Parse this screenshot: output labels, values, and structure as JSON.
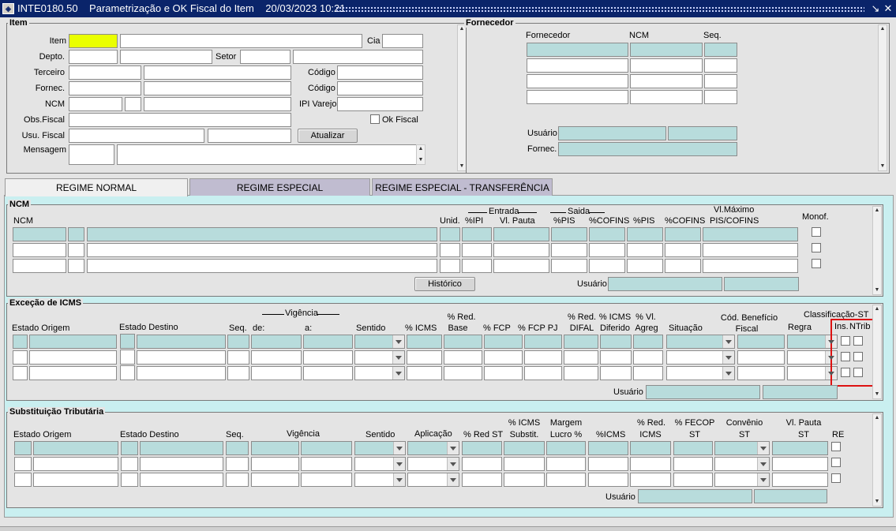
{
  "window": {
    "title": "INTE0180.50    Parametrização e OK Fiscal do Item    20/03/2023 10:21",
    "icon": "app-icon",
    "controls": [
      "chevron-down-icon",
      "close-icon"
    ]
  },
  "item": {
    "title": "Item",
    "labels": {
      "item": "Item",
      "cia": "Cia",
      "depto": "Depto.",
      "setor": "Setor",
      "terceiro": "Terceiro",
      "codigo1": "Código",
      "fornec": "Fornec.",
      "codigo2": "Código",
      "ncm": "NCM",
      "ipi_varejo": "IPI Varejo",
      "obs_fiscal": "Obs.Fiscal",
      "ok_fiscal": "Ok Fiscal",
      "usu_fiscal": "Usu. Fiscal",
      "mensagem": "Mensagem"
    },
    "atualizar": "Atualizar"
  },
  "fornecedor": {
    "title": "Fornecedor",
    "cols": {
      "fornecedor": "Fornecedor",
      "ncm": "NCM",
      "seq": "Seq."
    },
    "usuario": "Usuário",
    "fornec": "Fornec."
  },
  "tabs": [
    {
      "label": "REGIME NORMAL",
      "active": true
    },
    {
      "label": "REGIME ESPECIAL",
      "active": false
    },
    {
      "label": "REGIME ESPECIAL - TRANSFERÊNCIA",
      "active": false
    }
  ],
  "ncm_section": {
    "title": "NCM",
    "entrada": "Entrada",
    "saida": "Saida",
    "cols": {
      "ncm": "NCM",
      "unid": "Unid.",
      "pipi": "%IPI",
      "vl_pauta": "Vl. Pauta",
      "ppis": "%PIS",
      "pcofins": "%COFINS",
      "ppis2": "%PIS",
      "pcofins2": "%COFINS",
      "vl_max_1": "Vl.Máximo",
      "vl_max_2": "PIS/COFINS",
      "monof": "Monof."
    },
    "historico": "Histórico",
    "usuario": "Usuário"
  },
  "icms_section": {
    "title": "Exceção de ICMS",
    "vigencia": "Vigência",
    "class_st": "Classificação-ST",
    "cols": {
      "estado_origem": "Estado Origem",
      "estado_destino": "Estado Destino",
      "seq": "Seq.",
      "de": "de:",
      "a": "a:",
      "sentido": "Sentido",
      "picms": "% ICMS",
      "red_base_1": "% Red.",
      "red_base_2": "Base",
      "pfcp": "% FCP",
      "pfcp_pj": "% FCP PJ",
      "red_difal_1": "% Red.",
      "red_difal_2": "DIFAL",
      "icms_dif_1": "% ICMS",
      "icms_dif_2": "Diferido",
      "vl_agreg_1": "% Vl.",
      "vl_agreg_2": "Agreg",
      "situacao": "Situação",
      "cod_benef_1": "Cód. Benefício",
      "cod_benef_2": "Fiscal",
      "regra": "Regra",
      "ins": "Ins.",
      "ntrib": "NTrib"
    },
    "usuario": "Usuário"
  },
  "st_section": {
    "title": "Substituição Tributária",
    "cols": {
      "estado_origem": "Estado Origem",
      "estado_destino": "Estado Destino",
      "seq": "Seq.",
      "vigencia": "Vigência",
      "sentido": "Sentido",
      "aplicacao": "Aplicação",
      "pred_st": "% Red ST",
      "icms_subst_1": "% ICMS",
      "icms_subst_2": "Substit.",
      "margem_1": "Margem",
      "margem_2": "Lucro %",
      "picms": "%ICMS",
      "red_icms_1": "% Red.",
      "red_icms_2": "ICMS",
      "fecop_1": "% FECOP",
      "fecop_2": "ST",
      "convenio_1": "Convênio",
      "convenio_2": "ST",
      "vl_pauta_1": "Vl. Pauta",
      "vl_pauta_2": "ST",
      "re": "RE"
    },
    "usuario": "Usuário"
  },
  "colors": {
    "title_bar": "#0a246a",
    "teal_field": "#b8dcdc",
    "focus_field": "#eaff00",
    "highlight": "#dd1111"
  }
}
